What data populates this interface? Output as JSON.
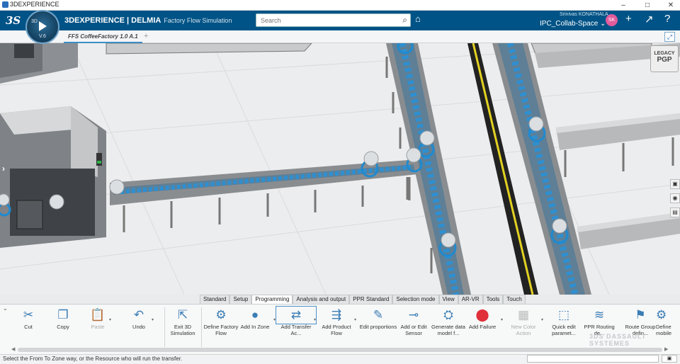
{
  "os": {
    "app_name": "3DEXPERIENCE",
    "minimize": "–",
    "maximize": "□",
    "close": "✕"
  },
  "header": {
    "compass_top": "3D",
    "compass_version": "V.6",
    "ds_logo": "3S",
    "brand_bold": "3DEXPERIENCE | DELMIA",
    "brand_app": "Factory Flow Simulation",
    "search_placeholder": "Search",
    "user_name": "Srinivas KONATHALA",
    "collab_space": "IPC_Collab-Space",
    "avatar_initials": "SK",
    "colors": {
      "bar": "#005386",
      "accent": "#3c8dc4"
    }
  },
  "tabs": {
    "document": "FFS CoffeeFactory 1.0 A.1",
    "add": "+"
  },
  "viewport": {
    "legacy_line1": "LEGACY",
    "legacy_line2": "PGP",
    "side_chevron": "›"
  },
  "tool_tabs": [
    {
      "label": "Standard",
      "active": false
    },
    {
      "label": "Setup",
      "active": false
    },
    {
      "label": "Programming",
      "active": true
    },
    {
      "label": "Analysis and output",
      "active": false
    },
    {
      "label": "PPR Standard",
      "active": false
    },
    {
      "label": "Selection mode",
      "active": false
    },
    {
      "label": "View",
      "active": false
    },
    {
      "label": "AR-VR",
      "active": false
    },
    {
      "label": "Tools",
      "active": false
    },
    {
      "label": "Touch",
      "active": false
    }
  ],
  "toolbar": {
    "cut": "Cut",
    "copy": "Copy",
    "paste": "Paste",
    "undo": "Undo",
    "exit_sim": "Exit 3D Simulation",
    "define_flow": "Define Factory Flow",
    "add_in_zone": "Add In Zone",
    "add_transfer": "Add Transfer Ac...",
    "add_product_flow": "Add Product Flow",
    "edit_proportions": "Edit proportions",
    "add_sensor": "Add or Edit Sensor",
    "generate_model": "Generate data model f...",
    "add_failure": "Add Failure",
    "new_color_action": "New Color Action",
    "quick_edit": "Quick edit paramet...",
    "ppr_routing": "PPR Routing de...",
    "route_group": "Route Group defin...",
    "define_mobile": "Define mobile"
  },
  "watermark": "3DS DASSAULT SYSTEMES",
  "status": {
    "message": "Select the From To Zone way, or the Resource who will run the transfer."
  }
}
